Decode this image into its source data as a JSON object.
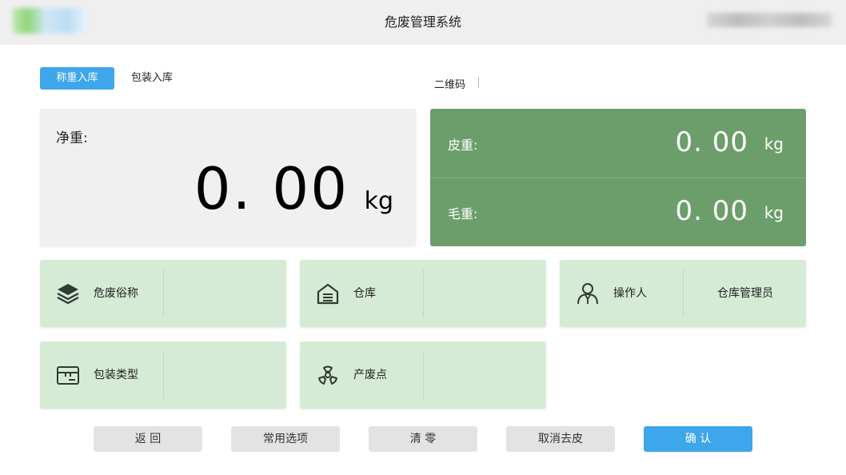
{
  "header": {
    "title": "危废管理系统"
  },
  "tabs": [
    {
      "label": "称重入库",
      "active": true
    },
    {
      "label": "包装入库",
      "active": false
    }
  ],
  "qr": {
    "label": "二维码"
  },
  "net": {
    "label": "净重:",
    "value": "0. 00",
    "unit": "kg"
  },
  "tare": {
    "label": "皮重:",
    "value": "0. 00",
    "unit": "kg"
  },
  "gross": {
    "label": "毛重:",
    "value": "0. 00",
    "unit": "kg"
  },
  "cards": {
    "waste_name": {
      "label": "危废俗称",
      "icon": "layers-icon",
      "value": ""
    },
    "warehouse": {
      "label": "仓库",
      "icon": "warehouse-icon",
      "value": ""
    },
    "operator": {
      "label": "操作人",
      "icon": "person-icon",
      "value": "仓库管理员"
    },
    "package_type": {
      "label": "包装类型",
      "icon": "box-icon",
      "value": ""
    },
    "waste_point": {
      "label": "产废点",
      "icon": "radiation-icon",
      "value": ""
    }
  },
  "buttons": {
    "back": "返 回",
    "common": "常用选项",
    "clear": "清 零",
    "cancel_tare": "取消去皮",
    "confirm": "确 认"
  },
  "colors": {
    "accent": "#3ea6ea",
    "panel_green": "#6b9e6b",
    "card_green": "#d5ebd5"
  }
}
